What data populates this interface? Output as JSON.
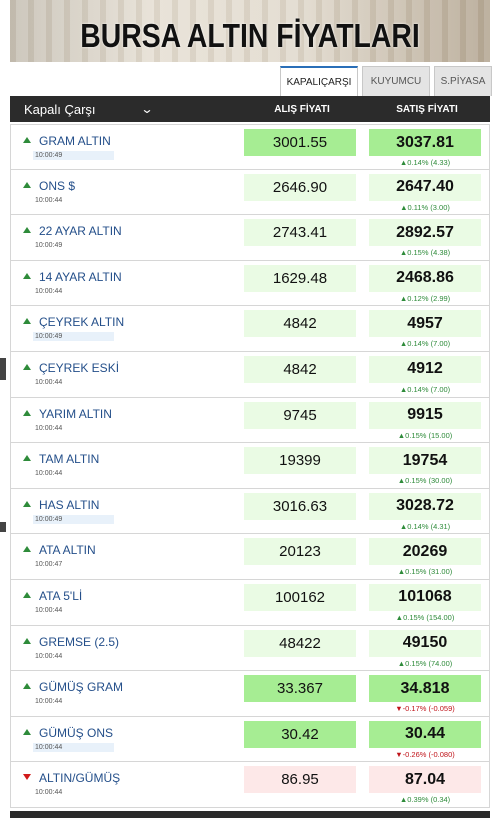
{
  "banner": {
    "title": "BURSA ALTIN FİYATLARI"
  },
  "tabs": [
    {
      "label": "KAPALIÇARŞI",
      "active": true
    },
    {
      "label": "KUYUMCU",
      "active": false
    },
    {
      "label": "S.PİYASA",
      "active": false
    }
  ],
  "header": {
    "market_select": "Kapalı Çarşı",
    "buy_label": "ALIŞ FİYATI",
    "sell_label": "SATIŞ FİYATI"
  },
  "colors": {
    "up": "#2e8b3a",
    "down": "#c0141a",
    "name": "#244f8a",
    "highlight": "#a6ed93"
  },
  "rows": [
    {
      "name": "GRAM ALTIN",
      "time": "10:00:49",
      "buy": "3001.55",
      "sell": "3037.81",
      "change": "▲0.14% (4.33)",
      "dir": "up",
      "strong": true,
      "hl_time": true
    },
    {
      "name": "ONS $",
      "time": "10:00:44",
      "buy": "2646.90",
      "sell": "2647.40",
      "change": "▲0.11% (3.00)",
      "dir": "up",
      "strong": false,
      "hl_time": false
    },
    {
      "name": "22 AYAR ALTIN",
      "time": "10:00:49",
      "buy": "2743.41",
      "sell": "2892.57",
      "change": "▲0.15% (4.38)",
      "dir": "up",
      "strong": false,
      "hl_time": false
    },
    {
      "name": "14 AYAR ALTIN",
      "time": "10:00:44",
      "buy": "1629.48",
      "sell": "2468.86",
      "change": "▲0.12% (2.99)",
      "dir": "up",
      "strong": false,
      "hl_time": false
    },
    {
      "name": "ÇEYREK ALTIN",
      "time": "10:00:49",
      "buy": "4842",
      "sell": "4957",
      "change": "▲0.14% (7.00)",
      "dir": "up",
      "strong": false,
      "hl_time": true
    },
    {
      "name": "ÇEYREK ESKİ",
      "time": "10:00:44",
      "buy": "4842",
      "sell": "4912",
      "change": "▲0.14% (7.00)",
      "dir": "up",
      "strong": false,
      "hl_time": false
    },
    {
      "name": "YARIM ALTIN",
      "time": "10:00:44",
      "buy": "9745",
      "sell": "9915",
      "change": "▲0.15% (15.00)",
      "dir": "up",
      "strong": false,
      "hl_time": false
    },
    {
      "name": "TAM ALTIN",
      "time": "10:00:44",
      "buy": "19399",
      "sell": "19754",
      "change": "▲0.15% (30.00)",
      "dir": "up",
      "strong": false,
      "hl_time": false
    },
    {
      "name": "HAS ALTIN",
      "time": "10:00:49",
      "buy": "3016.63",
      "sell": "3028.72",
      "change": "▲0.14% (4.31)",
      "dir": "up",
      "strong": false,
      "hl_time": true
    },
    {
      "name": "ATA ALTIN",
      "time": "10:00:47",
      "buy": "20123",
      "sell": "20269",
      "change": "▲0.15% (31.00)",
      "dir": "up",
      "strong": false,
      "hl_time": false
    },
    {
      "name": "ATA 5'Lİ",
      "time": "10:00:44",
      "buy": "100162",
      "sell": "101068",
      "change": "▲0.15% (154.00)",
      "dir": "up",
      "strong": false,
      "hl_time": false
    },
    {
      "name": "GREMSE (2.5)",
      "time": "10:00:44",
      "buy": "48422",
      "sell": "49150",
      "change": "▲0.15% (74.00)",
      "dir": "up",
      "strong": false,
      "hl_time": false
    },
    {
      "name": "GÜMÜŞ GRAM",
      "time": "10:00:44",
      "buy": "33.367",
      "sell": "34.818",
      "change": "▼-0.17% (-0.059)",
      "dir": "up",
      "neg": true,
      "strong": true,
      "hl_time": false
    },
    {
      "name": "GÜMÜŞ ONS",
      "time": "10:00:44",
      "buy": "30.42",
      "sell": "30.44",
      "change": "▼-0.26% (-0.080)",
      "dir": "up",
      "neg": true,
      "strong": true,
      "hl_time": true
    },
    {
      "name": "ALTIN/GÜMÜŞ",
      "time": "10:00:44",
      "buy": "86.95",
      "sell": "87.04",
      "change": "▲0.39% (0.34)",
      "dir": "down",
      "strong": false,
      "hl_time": false
    }
  ]
}
